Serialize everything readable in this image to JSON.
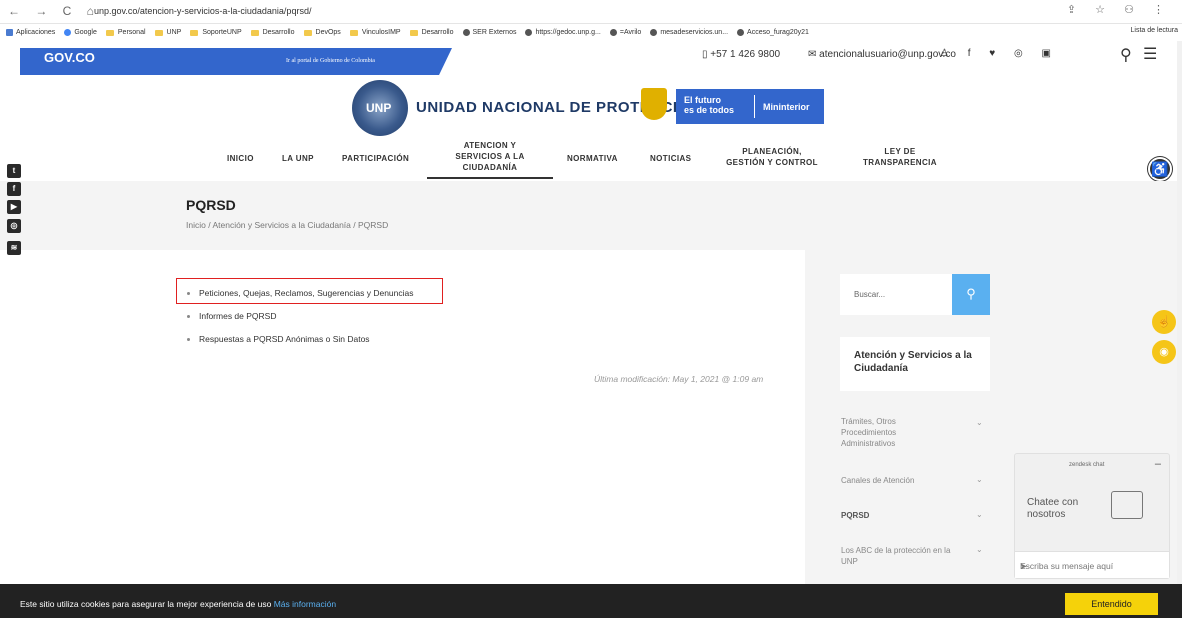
{
  "browser": {
    "url": "unp.gov.co/atencion-y-servicios-a-la-ciudadania/pqrsd/",
    "nav_icons": "← → C ⌂",
    "right_icons": "⇪ ☆ ⚇ ⋮"
  },
  "bookmarks": [
    {
      "label": "Aplicaciones",
      "icon": "apps-icon"
    },
    {
      "label": "Google",
      "icon": "google-icon"
    },
    {
      "label": "Personal",
      "icon": "folder-icon"
    },
    {
      "label": "UNP",
      "icon": "folder-icon"
    },
    {
      "label": "SoporteUNP",
      "icon": "folder-icon"
    },
    {
      "label": "Desarrollo",
      "icon": "folder-icon"
    },
    {
      "label": "DevOps",
      "icon": "folder-icon"
    },
    {
      "label": "VinculosIMP",
      "icon": "folder-icon"
    },
    {
      "label": "Desarrollo",
      "icon": "folder-icon"
    },
    {
      "label": "SER Externos",
      "icon": "globe-icon"
    },
    {
      "label": "https://gedoc.unp.g...",
      "icon": "globe-icon"
    },
    {
      "label": "=Avrilo",
      "icon": "globe-icon"
    },
    {
      "label": "mesadeservicios.un...",
      "icon": "globe-icon"
    },
    {
      "label": "Acceso_furag20y21",
      "icon": "globe-icon"
    }
  ],
  "reading_list": "Lista de lectura",
  "gov": {
    "logo": "GOV.CO",
    "link": "Ir al portal de Gobierno de Colombia"
  },
  "contact": {
    "phone": "+57 1 426 9800",
    "email": "atencionalusuario@unp.gov.co",
    "social": "♙ f ♥ ◎ ▣"
  },
  "header": {
    "emblem": "UNP",
    "title": "UNIDAD NACIONAL DE PROTECCIÓN",
    "futuro": "El futuro\nes de todos",
    "ministry": "Mininterior"
  },
  "nav": [
    "INICIO",
    "LA UNP",
    "PARTICIPACIÓN",
    "ATENCION Y\nSERVICIOS A LA\nCIUDADANÍA",
    "NORMATIVA",
    "NOTICIAS",
    "PLANEACIÓN,\nGESTIÓN Y CONTROL",
    "LEY DE\nTRANSPARENCIA"
  ],
  "page": {
    "title": "PQRSD",
    "breadcrumb": "Inicio  /  Atención y Servicios a la Ciudadanía  /  PQRSD"
  },
  "links": [
    "Peticiones, Quejas, Reclamos, Sugerencias y Denuncias",
    "Informes de PQRSD",
    "Respuestas a PQRSD Anónimas o Sin Datos"
  ],
  "last_modified": "Última modificación: May 1, 2021 @ 1:09 am",
  "sidebar": {
    "search_placeholder": "Buscar...",
    "section_title": "Atención y Servicios a la Ciudadanía",
    "items": [
      "Trámites, Otros\nProcedimientos\nAdministrativos",
      "Canales de Atención",
      "PQRSD",
      "Los ABC de la protección en la\nUNP"
    ]
  },
  "chat": {
    "header": "zendesk chat",
    "message": "Chatee con\nnosotros",
    "input_placeholder": "Escriba su mensaje aquí"
  },
  "cookie": {
    "text": "Este sitio utiliza cookies para asegurar la mejor experiencia de uso ",
    "link": "Más información",
    "button": "Entendido"
  }
}
